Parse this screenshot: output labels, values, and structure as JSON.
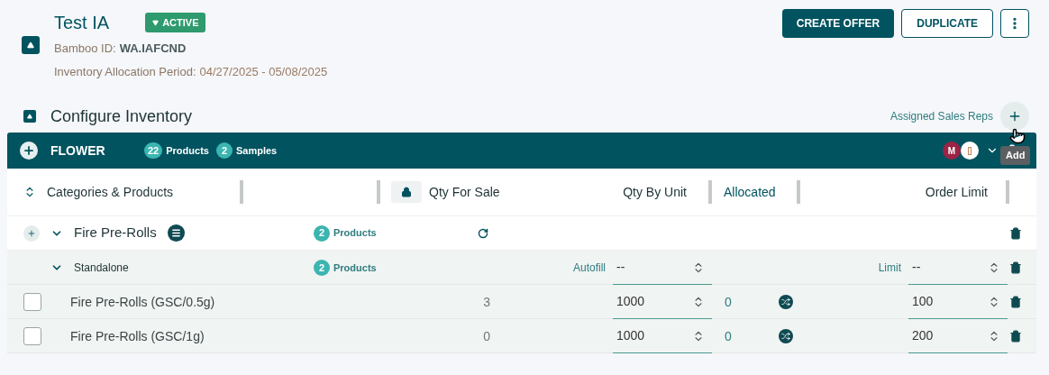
{
  "header": {
    "title": "Test IA",
    "status": "ACTIVE",
    "bamboo_id_label": "Bamboo ID:",
    "bamboo_id": "WA.IAFCND",
    "period_label": "Inventory Allocation Period:",
    "period": "04/27/2025 - 05/08/2025",
    "buttons": [
      {
        "label": "CREATE OFFER",
        "kind": "primary"
      },
      {
        "label": "DUPLICATE",
        "kind": "outline"
      }
    ]
  },
  "section": {
    "title": "Configure Inventory",
    "assigned_label": "Assigned Sales Reps",
    "tooltip": "Add"
  },
  "category": {
    "name": "FLOWER",
    "products_count": "22",
    "products_label": "Products",
    "samples_count": "2",
    "samples_label": "Samples",
    "avatars": [
      {
        "kind": "initial",
        "text": "M",
        "color": "#9b2345"
      },
      {
        "kind": "logo",
        "color": "#ffffff"
      }
    ]
  },
  "table": {
    "columns": [
      "Categories & Products",
      "Qty For Sale",
      "Qty By Unit",
      "Allocated",
      "Order Limit"
    ],
    "rows": [
      {
        "kind": "group",
        "name": "Fire Pre-Rolls",
        "count": "2",
        "count_label": "Products",
        "expanded": true
      },
      {
        "kind": "subgroup",
        "name": "Standalone",
        "count": "2",
        "count_label": "Products",
        "expanded": true,
        "autofill_label": "Autofill",
        "autofill": "--",
        "limit_label": "Limit",
        "limit": "--"
      },
      {
        "kind": "product",
        "name": "Fire Pre-Rolls (GSC/0.5g)",
        "checked": false,
        "qty_for_sale": "3",
        "qty_by_unit": "1000",
        "allocated": "0",
        "order_limit": "100"
      },
      {
        "kind": "product",
        "name": "Fire Pre-Rolls (GSC/1g)",
        "checked": false,
        "qty_for_sale": "0",
        "qty_by_unit": "1000",
        "allocated": "0",
        "order_limit": "200"
      }
    ]
  }
}
